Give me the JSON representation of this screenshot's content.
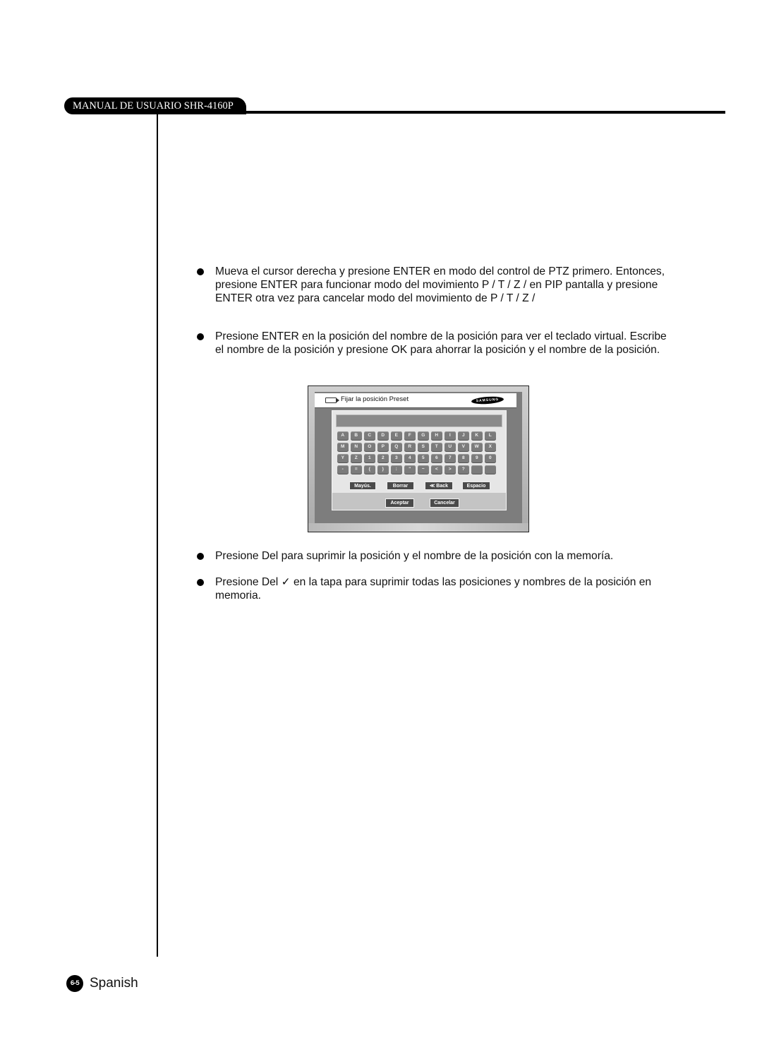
{
  "header": {
    "manual_title": "MANUAL DE USUARIO SHR-4160P"
  },
  "bullets": [
    "Mueva el cursor derecha y presione ENTER en modo del control de PTZ primero. Entonces, presione ENTER para funcionar modo del movimiento P / T / Z / en PIP pantalla y presione ENTER otra vez para cancelar modo del movimiento de P / T / Z /",
    "Presione ENTER en la posición del nombre de la posición para ver el teclado virtual. Escribe el nombre de la posición y presione OK para ahorrar la posición y el nombre de la posición.",
    "Presione Del para suprimir la posición y el nombre de la posición con la memoría.",
    "Presione Del ✓ en la tapa para suprimir todas las posiciones y nombres de la posición en memoria."
  ],
  "osd": {
    "title": "Fijar la posición Preset",
    "brand": "SAMSUNG",
    "input_value": "",
    "keys": [
      [
        "A",
        "B",
        "C",
        "D",
        "E",
        "F",
        "G",
        "H",
        "I",
        "J",
        "K",
        "L"
      ],
      [
        "M",
        "N",
        "O",
        "P",
        "Q",
        "R",
        "S",
        "T",
        "U",
        "V",
        "W",
        "X"
      ],
      [
        "Y",
        "Z",
        "1",
        "2",
        "3",
        "4",
        "5",
        "6",
        "7",
        "8",
        "9",
        "0"
      ],
      [
        "-",
        "=",
        "{",
        "}",
        ":",
        "\"",
        "~",
        "<",
        ">",
        "?",
        "",
        ""
      ]
    ],
    "function_buttons": {
      "shift": "Mayús.",
      "delete": "Borrar",
      "back": "≪ Back",
      "space": "Espacio"
    },
    "action_buttons": {
      "accept": "Aceptar",
      "cancel": "Cancelar"
    }
  },
  "footer": {
    "page_number": "6-5",
    "language": "Spanish"
  }
}
